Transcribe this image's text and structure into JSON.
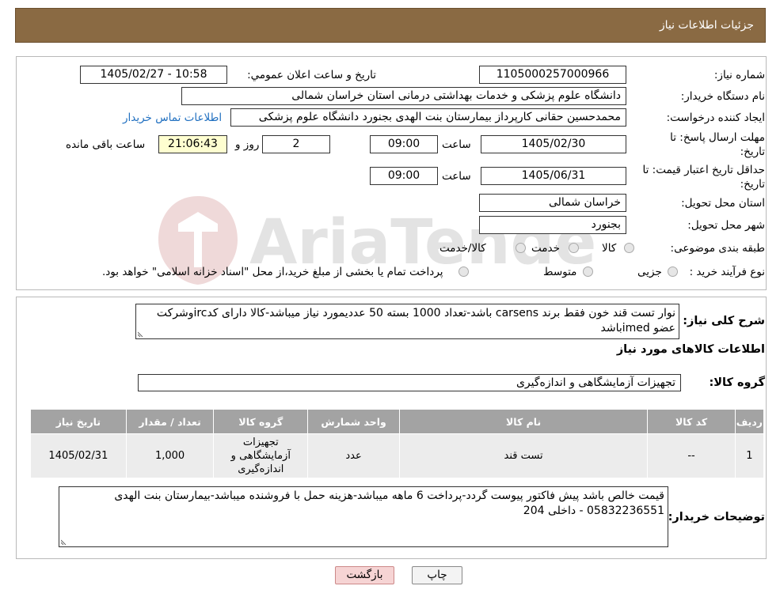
{
  "header": {
    "title": "جزئیات اطلاعات نیاز"
  },
  "need_info": {
    "need_number_label": "شماره نیاز:",
    "need_number": "1105000257000966",
    "announce_label": "تاریخ و ساعت اعلان عمومي:",
    "announce_value": "1405/02/27 - 10:58",
    "buyer_org_label": "نام دستگاه خریدار:",
    "buyer_org": "دانشگاه علوم پزشکی و خدمات بهداشتی درمانی استان خراسان شمالی",
    "creator_label": "ایجاد کننده درخواست:",
    "creator": "محمدحسین حقانی کارپرداز بیمارستان بنت الهدی بجنورد دانشگاه علوم پزشکی",
    "contact_link": "اطلاعات تماس خریدار",
    "deadline_label_1": "مهلت ارسال پاسخ: تا",
    "deadline_label_2": "تاریخ:",
    "deadline_date": "1405/02/30",
    "time_label": "ساعت",
    "deadline_time": "09:00",
    "days_value": "2",
    "days_label": "روز و",
    "remaining_time": "21:06:43",
    "remaining_label": "ساعت باقی مانده",
    "validity_label_1": "حداقل تاریخ اعتبار قیمت: تا",
    "validity_label_2": "تاریخ:",
    "validity_date": "1405/06/31",
    "validity_time": "09:00",
    "province_label": "استان محل تحویل:",
    "province": "خراسان شمالی",
    "city_label": "شهر محل تحویل:",
    "city": "بجنورد",
    "category_label": "طبقه بندی موضوعی:",
    "category_options": [
      "کالا",
      "خدمت",
      "کالا/خدمت"
    ],
    "process_label": "نوع فرآیند خرید :",
    "process_options": [
      "جزیی",
      "متوسط"
    ],
    "process_note": "پرداخت تمام یا بخشی از مبلغ خرید،از محل \"اسناد خزانه اسلامی\" خواهد بود."
  },
  "watermark": {
    "text": "AriaTender.neT"
  },
  "description": {
    "label": "شرح کلی نیاز:",
    "text": "نوار تست قند خون فقط برند carsens باشد-تعداد 1000 بسته 50 عددیمورد نیاز میباشد-کالا دارای کدircوشرکت عضو imedباشد"
  },
  "goods_section": {
    "title": "اطلاعات کالاهای مورد نیاز",
    "group_label": "گروه کالا:",
    "group_value": "تجهیزات آزمایشگاهی و اندازه‌گیری"
  },
  "table": {
    "headers": [
      "ردیف",
      "کد کالا",
      "نام کالا",
      "واحد شمارش",
      "گروه کالا",
      "تعداد / مقدار",
      "تاریخ نیاز"
    ],
    "rows": [
      [
        "1",
        "--",
        "تست قند",
        "عدد",
        "تجهیزات آزمایشگاهی و اندازه‌گیری",
        "1,000",
        "1405/02/31"
      ]
    ]
  },
  "buyer_notes": {
    "label": "توضیحات خریدار:",
    "text": "قیمت خالص باشد پیش فاکتور پیوست گردد-پرداخت 6 ماهه میباشد-هزینه حمل با فروشنده میباشد-بیمارستان بنت الهدی 05832236551 - داخلی 204"
  },
  "buttons": {
    "print": "چاپ",
    "back": "بازگشت"
  },
  "colors": {
    "header_bg": "#8a6a43",
    "table_header_bg": "#a3a3a3",
    "back_button_bg": "#f6d4d4"
  }
}
